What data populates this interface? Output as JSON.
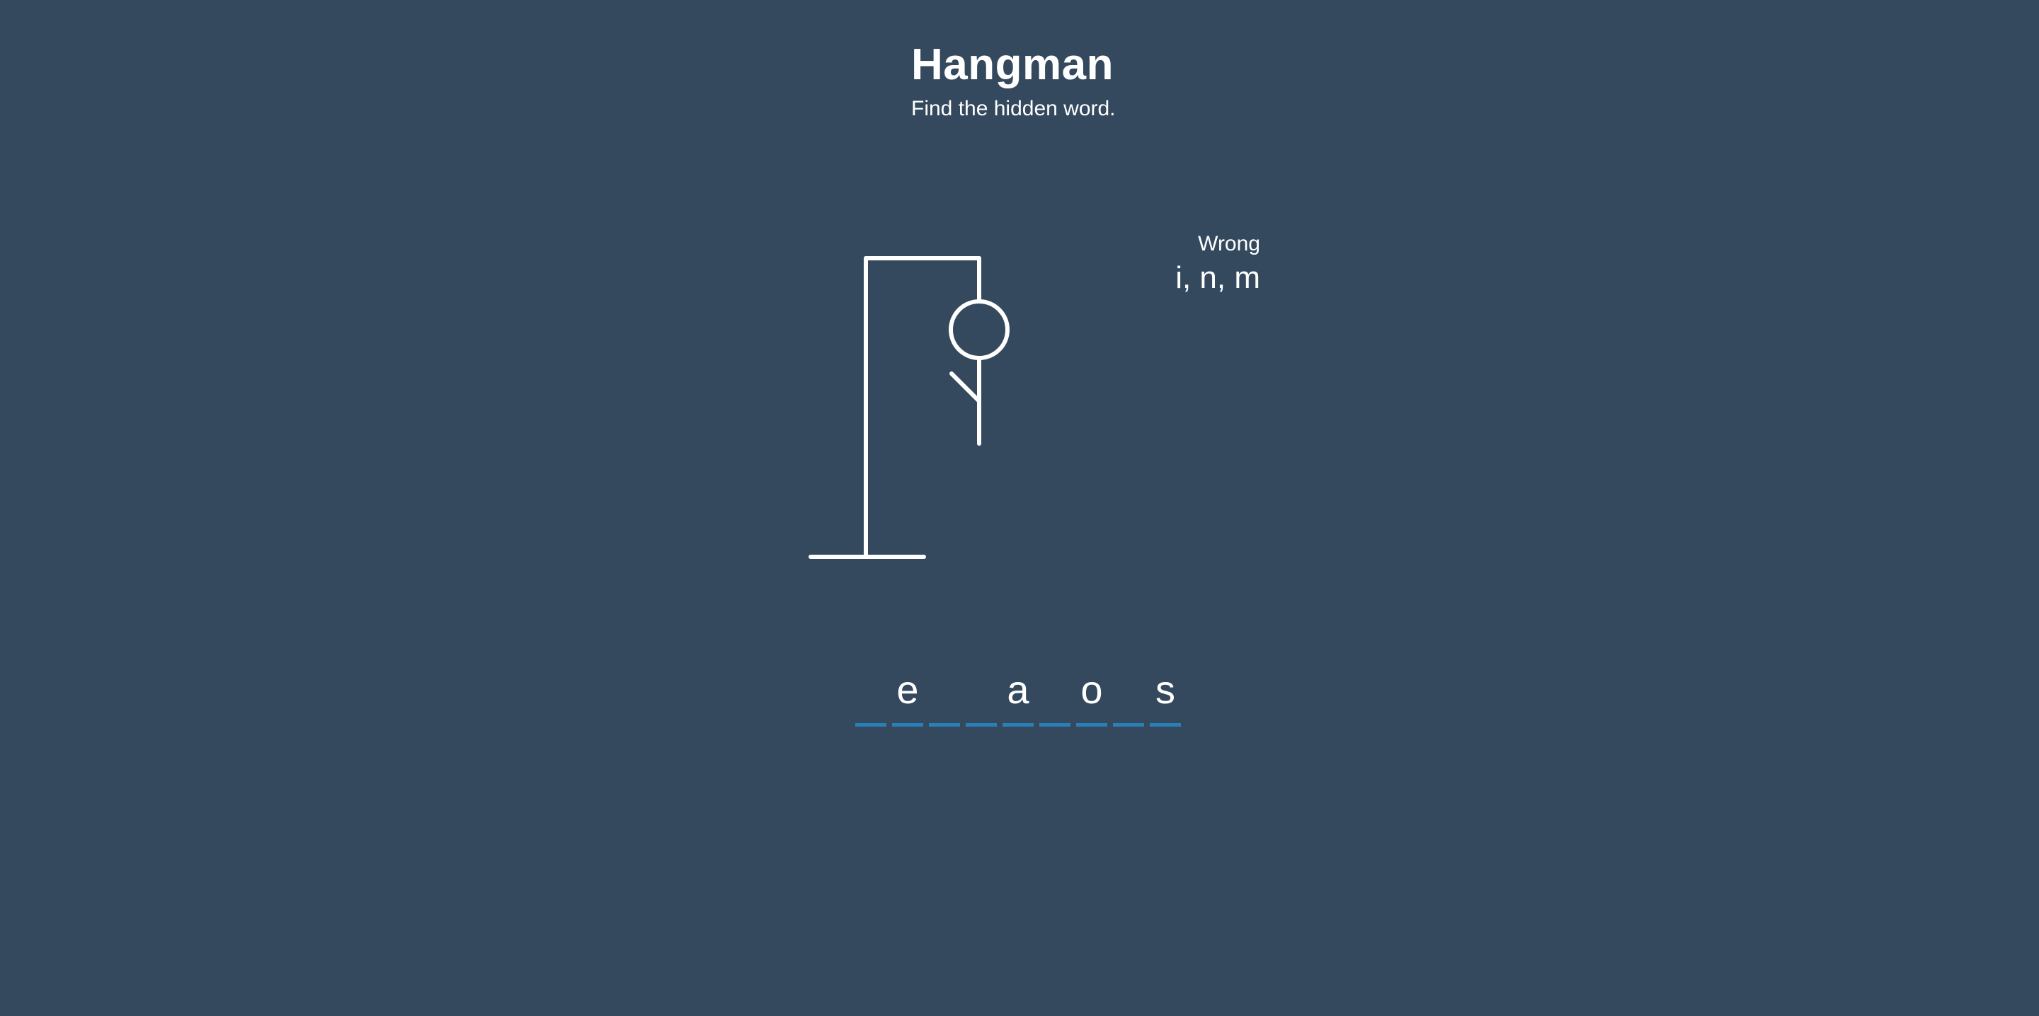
{
  "game": {
    "title": "Hangman",
    "subtitle": "Find the hidden word."
  },
  "wrong": {
    "label": "Wrong",
    "letters_text": "i, n, m",
    "letters": [
      "i",
      "n",
      "m"
    ]
  },
  "word": {
    "slots": [
      "",
      "e",
      "",
      "",
      "a",
      "",
      "o",
      "",
      "s"
    ]
  },
  "figure": {
    "parts_shown": [
      "head",
      "body",
      "left-arm"
    ]
  },
  "colors": {
    "background": "#34495e",
    "figure": "#ffffff",
    "underline": "#2980b9"
  }
}
